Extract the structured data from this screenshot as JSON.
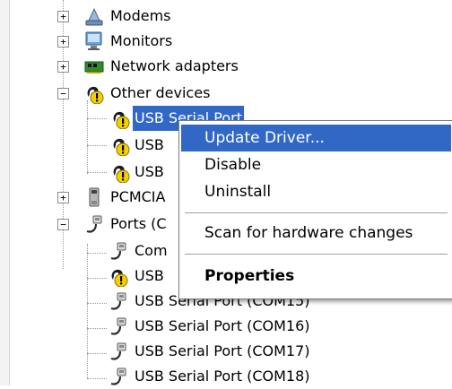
{
  "tree": {
    "modems": "Modems",
    "monitors": "Monitors",
    "network_adapters": "Network adapters",
    "other_devices": "Other devices",
    "other_children": [
      "USB Serial Port",
      "USB",
      "USB"
    ],
    "pcmcia": "PCMCIA",
    "ports": "Ports (C",
    "ports_children": [
      "Com",
      "USB",
      "USB Serial Port (COM15)",
      "USB Serial Port (COM16)",
      "USB Serial Port (COM17)",
      "USB Serial Port (COM18)"
    ]
  },
  "context_menu": {
    "update_driver": "Update Driver...",
    "disable": "Disable",
    "uninstall": "Uninstall",
    "scan": "Scan for hardware changes",
    "properties": "Properties"
  },
  "expander_symbols": {
    "collapsed": "+",
    "expanded": "−"
  },
  "colors": {
    "selection": "#3168c6",
    "warning": "#f5d000"
  }
}
